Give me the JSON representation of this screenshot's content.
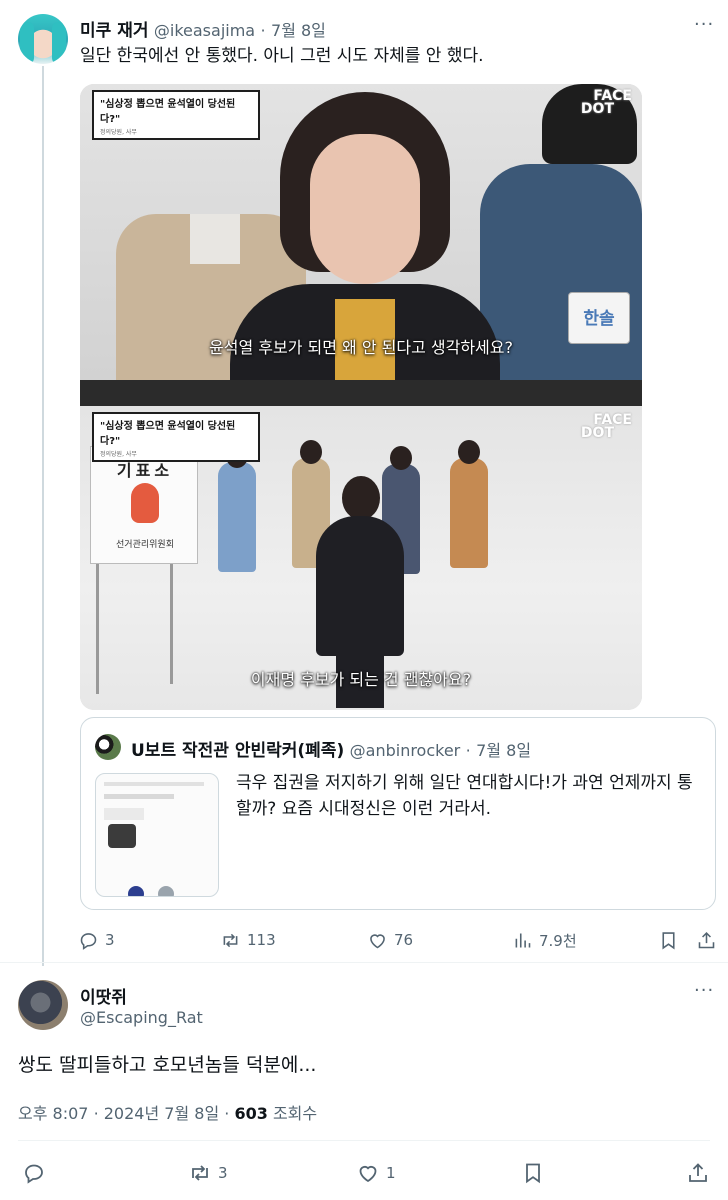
{
  "tweet": {
    "author_name": "미쿠 재거",
    "author_handle": "@ikeasajima",
    "separator": "·",
    "date": "7월 8일",
    "text": "일단 한국에선 안 통했다. 아니 그런 시도 자체를 안 했다.",
    "media": {
      "top_title": "\"심상정 뽑으면 윤석열이 당선된다?\"",
      "top_title_sub": "정의당원, 사무",
      "bottom_title": "\"심상정 뽑으면 윤석열이 당선된다?\"",
      "bottom_title_sub": "정의당원, 사무",
      "watermark_line1": "FACE",
      "watermark_line2": "DOT",
      "top_subtitle": "윤석열 후보가 되면 왜 안 된다고 생각하세요?",
      "bottom_subtitle": "이재명 후보가 되는 건 괜찮아요?",
      "badge": "한솔",
      "booth_label": "기표소",
      "booth_footer": "선거관리위원회"
    },
    "quote": {
      "author_name": "U보트 작전관 안빈락커(폐족)",
      "author_handle": "@anbinrocker",
      "separator": "·",
      "date": "7월 8일",
      "text": "극우 집권을 저지하기 위해 일단 연대합시다!가 과연 언제까지 통할까? 요즘 시대정신은 이런 거라서."
    },
    "actions": {
      "replies": "3",
      "retweets": "113",
      "likes": "76",
      "views": "7.9천"
    }
  },
  "reply": {
    "author_name": "이땃쥐",
    "author_handle": "@Escaping_Rat",
    "text": "쌍도 딸피들하고 호모년놈들 덕분에...",
    "time": "오후 8:07",
    "separator": "·",
    "date": "2024년 7월 8일",
    "views_count": "603",
    "views_label": "조회수",
    "actions": {
      "replies": "",
      "retweets": "3",
      "likes": "1"
    }
  },
  "icons": [
    "more-icon",
    "reply-icon",
    "retweet-icon",
    "like-icon",
    "views-icon",
    "bookmark-icon",
    "share-icon"
  ],
  "colors": {
    "text": "#0f1419",
    "muted": "#536471",
    "border": "#cfd9de"
  }
}
